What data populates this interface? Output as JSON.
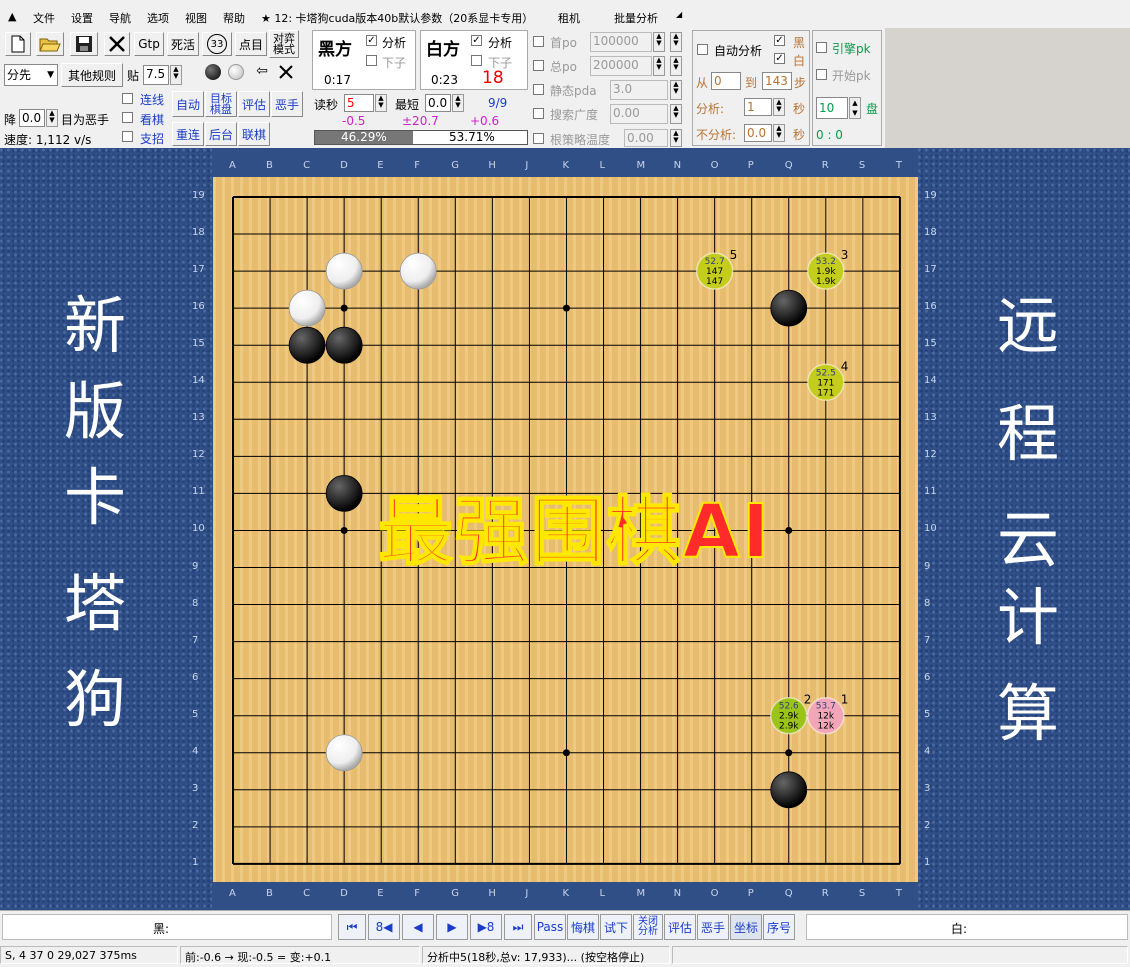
{
  "menu": {
    "app_icon": "triangle-up-icon",
    "items": [
      "文件",
      "设置",
      "导航",
      "选项",
      "视图",
      "帮助"
    ],
    "title": "★ 12: 卡塔狗cuda版本40b默认参数（20系显卡专用）",
    "extra1": "租机",
    "extra2": "批量分析",
    "extra_arrow": "◢"
  },
  "toolbar": {
    "gtp": "Gtp",
    "dead": "死活",
    "icon33": "33",
    "point": "点目",
    "match": "对弈模式",
    "handicap_select": "分先",
    "other_rules": "其他规则",
    "komi_label": "贴",
    "komi_value": "7.5",
    "drop_label": "降",
    "drop_value": "0.0",
    "target_bad": "目为恶手",
    "link_line": "连线",
    "watch": "看棋",
    "support": "支招",
    "auto": "自动",
    "target_board": "目标棋盘",
    "evaluate": "评估",
    "bad_move": "恶手",
    "reconnect": "重连",
    "backend": "后台",
    "online": "联棋",
    "speed": "速度: 1,112 v/s"
  },
  "black_panel": {
    "title": "黑方",
    "analyze": "分析",
    "play": "下子",
    "time": "0:17"
  },
  "white_panel": {
    "title": "白方",
    "analyze": "分析",
    "play": "下子",
    "time": "0:23",
    "move_count": "18"
  },
  "byo": {
    "label": "读秒",
    "value": "5",
    "min_label": "最短",
    "min_value": "0.0",
    "counter": "9/9",
    "d1": "-0.5",
    "d2": "±20.7",
    "d3": "+0.6"
  },
  "winrate": {
    "black": "46.29%",
    "white": "53.71%",
    "black_fraction": 0.4629
  },
  "limits": {
    "first_po": "首po",
    "first_po_val": "100000",
    "total_po": "总po",
    "total_po_val": "200000",
    "static_pda": "静态pda",
    "static_pda_val": "3.0",
    "search_width": "搜索广度",
    "search_width_val": "0.00",
    "root_temp": "根策略温度",
    "root_temp_val": "0.00"
  },
  "auto_analysis": {
    "title": "自动分析",
    "black": "黑",
    "white": "白",
    "from_label": "从",
    "from_val": "0",
    "to_label": "到",
    "to_val": "143",
    "step": "步",
    "analyze_label": "分析:",
    "analyze_val": "1",
    "sec": "秒",
    "noanalyze_label": "不分析:",
    "noanalyze_val": "0.0",
    "sec2": "秒"
  },
  "engine_pk": {
    "engine_pk": "引擎pk",
    "start_pk": "开始pk",
    "games_val": "10",
    "games_label": "盘",
    "score": "0 : 0"
  },
  "side_left_text": [
    "新",
    "版",
    "卡",
    "塔",
    "狗"
  ],
  "side_right_text": [
    "远",
    "程",
    "云",
    "计",
    "算"
  ],
  "banner": "最强围棋AI",
  "board": {
    "columns": [
      "A",
      "B",
      "C",
      "D",
      "E",
      "F",
      "G",
      "H",
      "J",
      "K",
      "L",
      "M",
      "N",
      "O",
      "P",
      "Q",
      "R",
      "S",
      "T"
    ],
    "rows": [
      "19",
      "18",
      "17",
      "16",
      "15",
      "14",
      "13",
      "12",
      "11",
      "10",
      "9",
      "8",
      "7",
      "6",
      "5",
      "4",
      "3",
      "2",
      "1"
    ],
    "stones": [
      {
        "color": "white",
        "col": 3,
        "row": 17
      },
      {
        "color": "white",
        "col": 5,
        "row": 17
      },
      {
        "color": "white",
        "col": 2,
        "row": 16
      },
      {
        "color": "black",
        "col": 2,
        "row": 15
      },
      {
        "color": "black",
        "col": 3,
        "row": 15
      },
      {
        "color": "black",
        "col": 15,
        "row": 16
      },
      {
        "color": "black",
        "col": 3,
        "row": 11
      },
      {
        "color": "white",
        "col": 3,
        "row": 4
      },
      {
        "color": "black",
        "col": 15,
        "row": 3
      }
    ],
    "candidates": [
      {
        "rank": "1",
        "col": 16,
        "row": 5,
        "winrate": "53.7",
        "v1": "12k",
        "v2": "12k",
        "color": "#f2a6b8"
      },
      {
        "rank": "2",
        "col": 15,
        "row": 5,
        "winrate": "52.6",
        "v1": "2.9k",
        "v2": "2.9k",
        "color": "#9cc21c"
      },
      {
        "rank": "3",
        "col": 16,
        "row": 17,
        "winrate": "53.2",
        "v1": "1.9k",
        "v2": "1.9k",
        "color": "#c4cc1c"
      },
      {
        "rank": "4",
        "col": 16,
        "row": 14,
        "winrate": "52.5",
        "v1": "171",
        "v2": "171",
        "color": "#c4cc1c"
      },
      {
        "rank": "5",
        "col": 13,
        "row": 17,
        "winrate": "52.7",
        "v1": "147",
        "v2": "147",
        "color": "#c4cc1c"
      }
    ]
  },
  "bottom": {
    "black_label": "黑:",
    "white_label": "白:",
    "first": "⏮",
    "back8": "8◀",
    "prev": "◀",
    "next": "▶",
    "fwd8": "▶8",
    "last": "⏭",
    "pass": "Pass",
    "undo": "悔棋",
    "try": "试下",
    "close_analysis": "关闭分析",
    "eval": "评估",
    "bad": "恶手",
    "coords": "坐标",
    "order": "序号"
  },
  "status": {
    "s1": "S,   4  37  0  29,027  375ms",
    "s2": "前:-0.6 → 现:-0.5 = 变:+0.1",
    "s3": "分析中5(18秒,总v: 17,933)... (按空格停止)"
  }
}
